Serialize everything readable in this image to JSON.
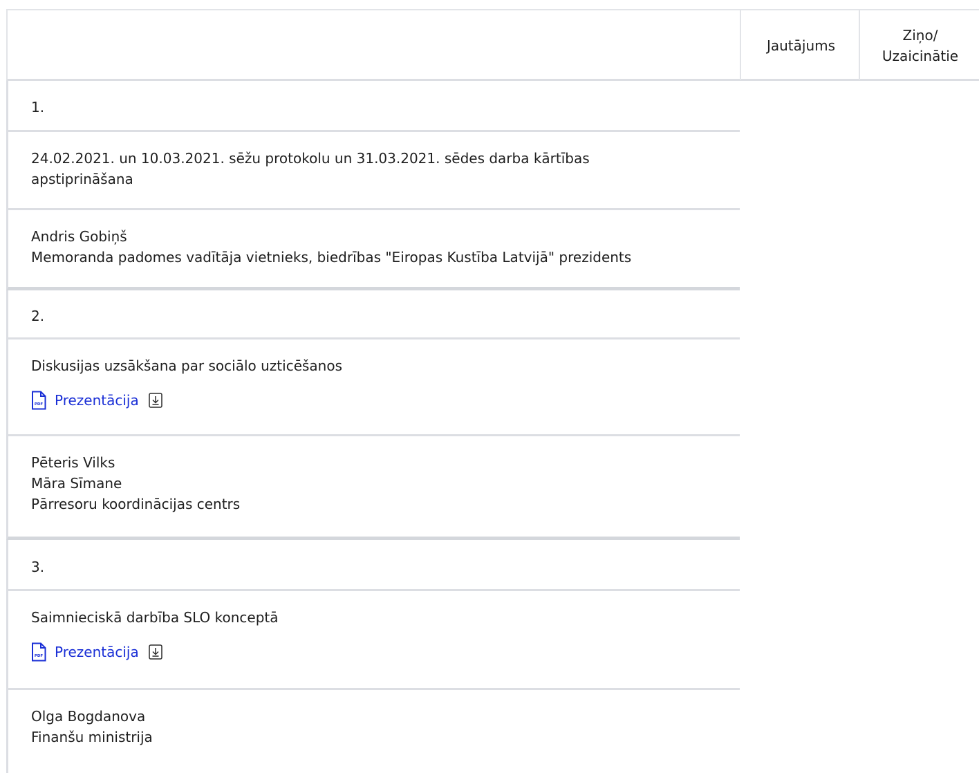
{
  "header": {
    "col_question": "Jautājums",
    "col_reporters_line1": "Ziņo/",
    "col_reporters_line2": "Uzaicinātie"
  },
  "agenda": [
    {
      "number": "1.",
      "topic_lines": [
        "24.02.2021. un 10.03.2021. sēžu protokolu un 31.03.2021. sēdes darba kārtības",
        "apstiprināšana"
      ],
      "people": [
        "Andris Gobiņš",
        "Memoranda padomes vadītāja vietnieks, biedrības \"Eiropas Kustība Latvijā\" prezidents"
      ]
    },
    {
      "number": "2.",
      "topic_lines": [
        "Diskusijas uzsākšana par sociālo uzticēšanos"
      ],
      "attachment": {
        "label": "Prezentācija",
        "icon": "pdf-file-icon",
        "action_icon": "download-icon"
      },
      "people": [
        "Pēteris Vilks",
        "Māra Sīmane",
        "Pārresoru koordinācijas centrs"
      ]
    },
    {
      "number": "3.",
      "topic_lines": [
        "Saimnieciskā darbība SLO konceptā"
      ],
      "attachment": {
        "label": "Prezentācija",
        "icon": "pdf-file-icon",
        "action_icon": "download-icon"
      },
      "people": [
        "Olga Bogdanova",
        "Finanšu ministrija"
      ]
    }
  ],
  "colors": {
    "link": "#1a2fd6",
    "border": "#dcdee3",
    "text": "#1f1f1f"
  }
}
